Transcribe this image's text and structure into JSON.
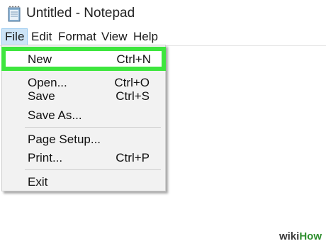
{
  "window": {
    "title": "Untitled - Notepad"
  },
  "menubar": {
    "items": [
      {
        "label": "File"
      },
      {
        "label": "Edit"
      },
      {
        "label": "Format"
      },
      {
        "label": "View"
      },
      {
        "label": "Help"
      }
    ]
  },
  "file_menu": {
    "items": [
      {
        "label": "New",
        "shortcut": "Ctrl+N"
      },
      {
        "label": "Open...",
        "shortcut": "Ctrl+O"
      },
      {
        "label": "Save",
        "shortcut": "Ctrl+S"
      },
      {
        "label": "Save As...",
        "shortcut": ""
      },
      {
        "label": "Page Setup...",
        "shortcut": ""
      },
      {
        "label": "Print...",
        "shortcut": "Ctrl+P"
      },
      {
        "label": "Exit",
        "shortcut": ""
      }
    ]
  },
  "watermark": {
    "part1": "wiki",
    "part2": "How"
  },
  "colors": {
    "highlight_border": "#3ee63e",
    "menu_active_bg": "#cce4f7",
    "dropdown_bg": "#f2f2f2"
  },
  "icons": {
    "app": "notepad-icon"
  }
}
